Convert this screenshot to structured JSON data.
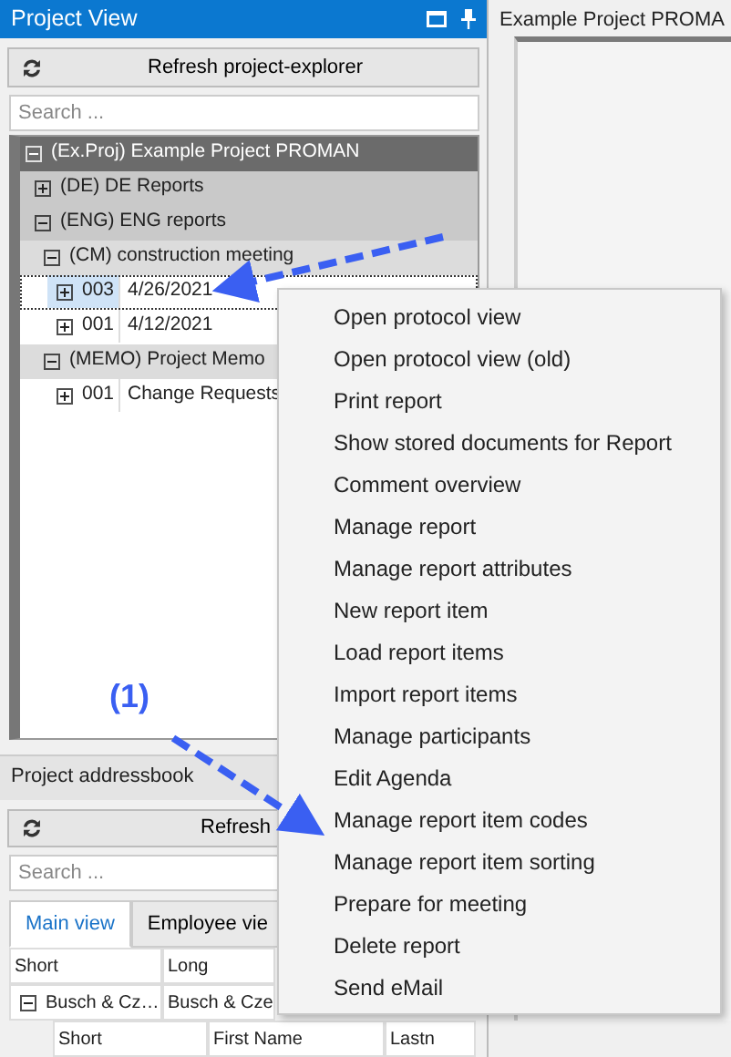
{
  "project_view": {
    "title": "Project View",
    "refresh_button": "Refresh project-explorer",
    "search": {
      "placeholder": "Search ..."
    },
    "tree": [
      {
        "label": "(Ex.Proj) Example Project PROMAN",
        "expanded": true,
        "children": [
          {
            "label": "(DE) DE Reports",
            "expanded": false
          },
          {
            "label": "(ENG) ENG reports",
            "expanded": true,
            "children": [
              {
                "label": "(CM) construction meeting",
                "expanded": true,
                "children": [
                  {
                    "number": "003",
                    "label": "4/26/2021",
                    "expanded": false,
                    "selected": true
                  },
                  {
                    "number": "001",
                    "label": "4/12/2021",
                    "expanded": false,
                    "selected": false
                  }
                ]
              },
              {
                "label": "(MEMO) Project Memo",
                "expanded": true,
                "children": [
                  {
                    "number": "001",
                    "label": "Change Requests",
                    "expanded": false,
                    "selected": false
                  }
                ]
              }
            ]
          }
        ]
      }
    ]
  },
  "document_tab": {
    "title": "Example Project PROMA"
  },
  "addressbook": {
    "title": "Project addressbook",
    "refresh_button": "Refresh",
    "search": {
      "placeholder": "Search ..."
    },
    "tabs": [
      {
        "label": "Main view",
        "selected": true
      },
      {
        "label": "Employee vie",
        "selected": false
      }
    ],
    "columns": [
      "Short",
      "Long"
    ],
    "rows": [
      {
        "short": "Busch & Cz…",
        "long": "Busch & Cze",
        "expanded": true
      }
    ],
    "sub_columns": [
      "Short",
      "First Name",
      "Lastn"
    ]
  },
  "context_menu": [
    "Open protocol view",
    "Open protocol view (old)",
    "Print report",
    "Show stored documents for Report",
    "Comment overview",
    "Manage report",
    "Manage report attributes",
    "New report item",
    "Load report items",
    "Import report items",
    "Manage participants",
    "Edit Agenda",
    "Manage report item codes",
    "Manage report item sorting",
    "Prepare for meeting",
    "Delete report",
    "Send eMail"
  ],
  "annotation": {
    "label": "(1)"
  }
}
